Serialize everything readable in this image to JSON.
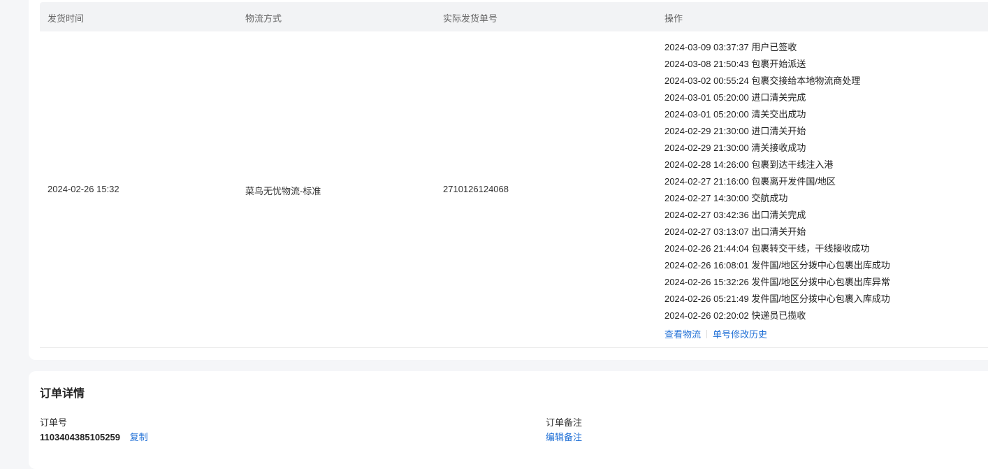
{
  "table": {
    "headers": [
      "发货时间",
      "物流方式",
      "实际发货单号",
      "操作"
    ],
    "row": {
      "ship_time": "2024-02-26 15:32",
      "method": "菜鸟无忧物流-标准",
      "tracking_no": "2710126124068"
    },
    "tracking_log": [
      "2024-03-09 03:37:37 用户已签收",
      "2024-03-08 21:50:43 包裹开始派送",
      "2024-03-02 00:55:24 包裹交接给本地物流商处理",
      "2024-03-01 05:20:00 进口清关完成",
      "2024-03-01 05:20:00 清关交出成功",
      "2024-02-29 21:30:00 进口清关开始",
      "2024-02-29 21:30:00 清关接收成功",
      "2024-02-28 14:26:00 包裹到达干线注入港",
      "2024-02-27 21:16:00 包裹离开发件国/地区",
      "2024-02-27 14:30:00 交航成功",
      "2024-02-27 03:42:36 出口清关完成",
      "2024-02-27 03:13:07 出口清关开始",
      "2024-02-26 21:44:04 包裹转交干线，干线接收成功",
      "2024-02-26 16:08:01 发件国/地区分拨中心包裹出库成功",
      "2024-02-26 15:32:26 发件国/地区分拨中心包裹出库异常",
      "2024-02-26 05:21:49 发件国/地区分拨中心包裹入库成功",
      "2024-02-26 02:20:02 快递员已揽收"
    ],
    "view_logistics": "查看物流",
    "edit_history": "单号修改历史"
  },
  "order": {
    "title": "订单详情",
    "order_no_label": "订单号",
    "order_no": "1103404385105259",
    "copy": "复制",
    "remark_label": "订单备注",
    "edit_remark": "编辑备注"
  }
}
